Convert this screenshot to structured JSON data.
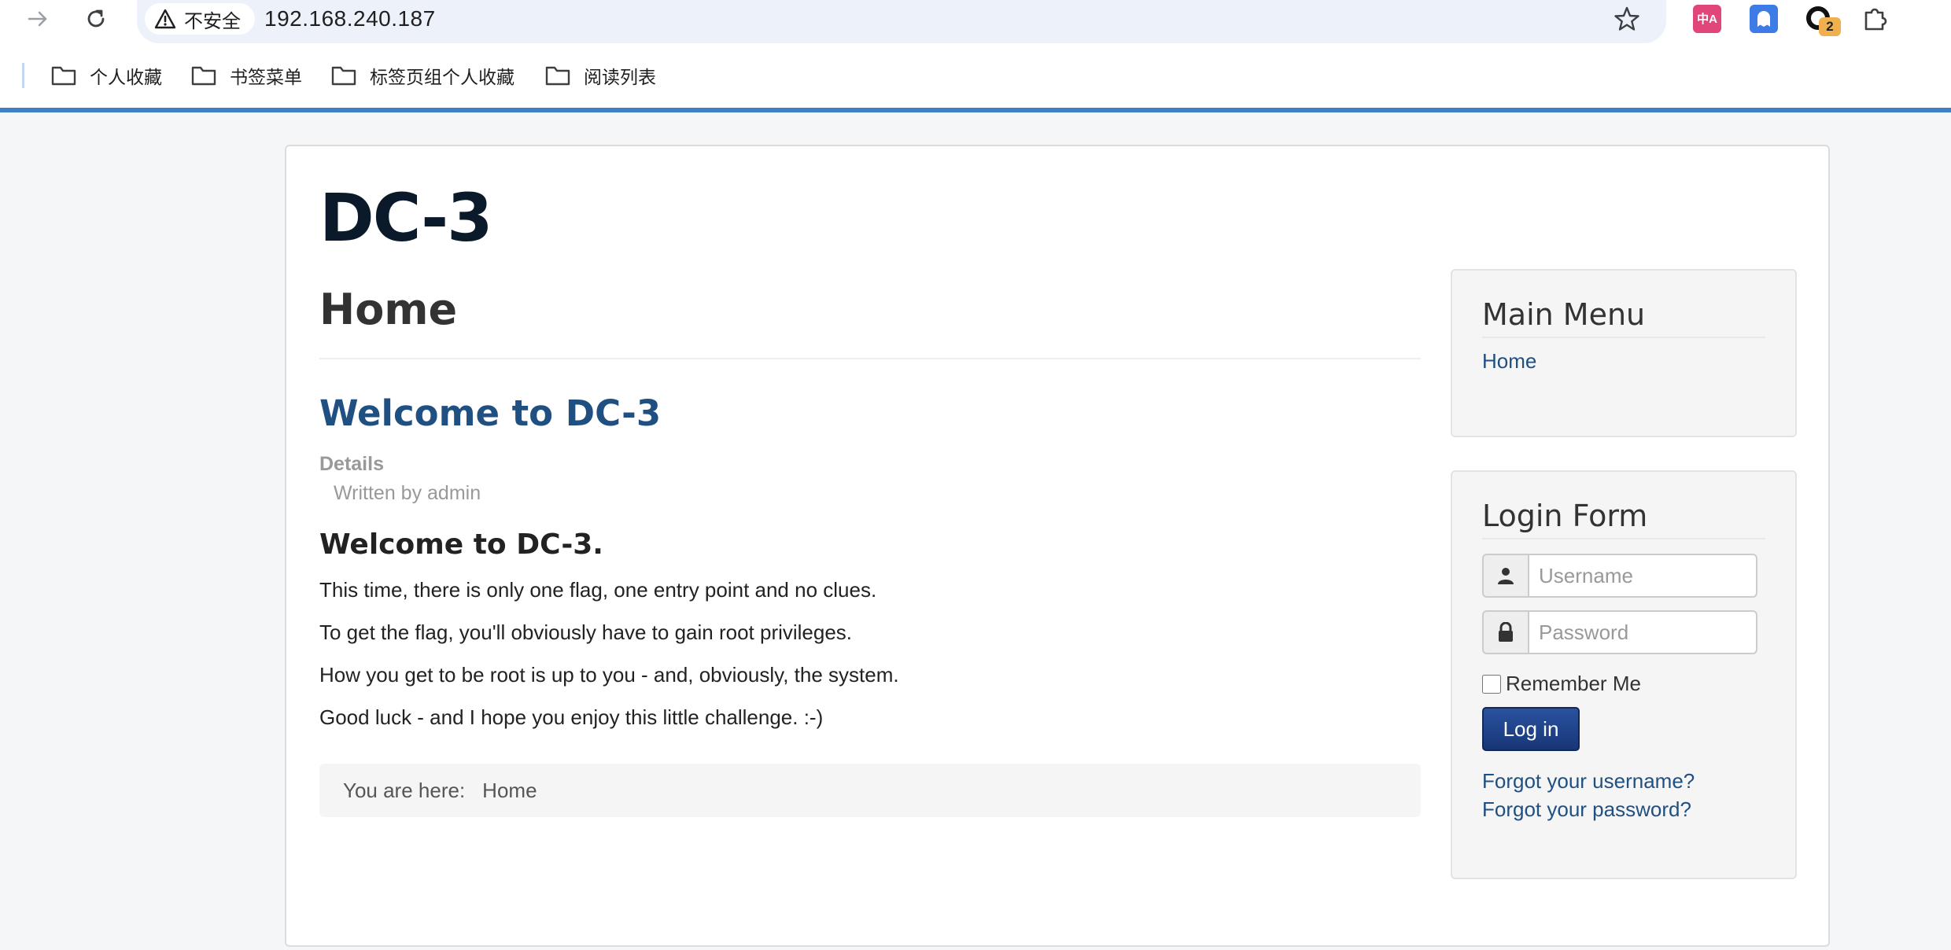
{
  "browser": {
    "security_label": "不安全",
    "url": "192.168.240.187",
    "extension_badge": "2",
    "translate_icon_text": "中A"
  },
  "bookmarks": [
    {
      "label": "个人收藏"
    },
    {
      "label": "书签菜单"
    },
    {
      "label": "标签页组个人收藏"
    },
    {
      "label": "阅读列表"
    }
  ],
  "site": {
    "brand": "DC-3"
  },
  "main": {
    "page_heading": "Home",
    "article_title": "Welcome to DC-3",
    "details_label": "Details",
    "written_by": "Written by admin",
    "subheading": "Welcome to DC-3.",
    "paragraphs": [
      "This time, there is only one flag, one entry point and no clues.",
      "To get the flag, you'll obviously have to gain root privileges.",
      "How you get to be root is up to you - and, obviously, the system.",
      "Good luck - and I hope you enjoy this little challenge.  :-)"
    ],
    "breadcrumb_prefix": "You are here:",
    "breadcrumb_current": "Home"
  },
  "sidebar": {
    "main_menu": {
      "title": "Main Menu",
      "items": [
        {
          "label": "Home"
        }
      ]
    },
    "login": {
      "title": "Login Form",
      "username_placeholder": "Username",
      "password_placeholder": "Password",
      "remember_label": "Remember Me",
      "submit_label": "Log in",
      "forgot_username": "Forgot your username?",
      "forgot_password": "Forgot your password?"
    }
  },
  "colors": {
    "link": "#205081",
    "accent_bar": "#3f7fc4",
    "button": "#1c3b7a"
  }
}
